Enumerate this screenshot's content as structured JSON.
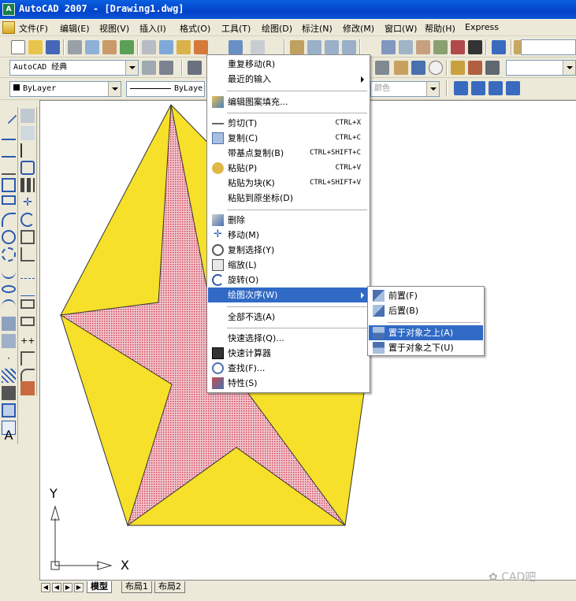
{
  "window": {
    "title": "AutoCAD 2007 - [Drawing1.dwg]",
    "app_icon": "autocad-icon"
  },
  "menubar": {
    "items": [
      "文件(F)",
      "编辑(E)",
      "视图(V)",
      "插入(I)",
      "格式(O)",
      "工具(T)",
      "绘图(D)",
      "标注(N)",
      "修改(M)",
      "窗口(W)",
      "帮助(H)",
      "Express"
    ]
  },
  "toolbar2": {
    "workspace": "AutoCAD 经典"
  },
  "toolbar3": {
    "layer_color": "ByLayer",
    "linetype": "ByLayer",
    "color_label": "颜色"
  },
  "context_menu": {
    "items": [
      {
        "label": "重复移动(R)",
        "shortcut": ""
      },
      {
        "label": "最近的输入",
        "shortcut": ""
      },
      {
        "label": "编辑图案填充...",
        "shortcut": ""
      },
      {
        "label": "剪切(T)",
        "shortcut": "CTRL+X"
      },
      {
        "label": "复制(C)",
        "shortcut": "CTRL+C"
      },
      {
        "label": "带基点复制(B)",
        "shortcut": "CTRL+SHIFT+C"
      },
      {
        "label": "粘贴(P)",
        "shortcut": "CTRL+V"
      },
      {
        "label": "粘贴为块(K)",
        "shortcut": "CTRL+SHIFT+V"
      },
      {
        "label": "粘贴到原坐标(D)",
        "shortcut": ""
      },
      {
        "label": "删除",
        "shortcut": ""
      },
      {
        "label": "移动(M)",
        "shortcut": ""
      },
      {
        "label": "复制选择(Y)",
        "shortcut": ""
      },
      {
        "label": "缩放(L)",
        "shortcut": ""
      },
      {
        "label": "旋转(O)",
        "shortcut": ""
      },
      {
        "label": "绘图次序(W)",
        "shortcut": ""
      },
      {
        "label": "全部不选(A)",
        "shortcut": ""
      },
      {
        "label": "快速选择(Q)...",
        "shortcut": ""
      },
      {
        "label": "快速计算器",
        "shortcut": ""
      },
      {
        "label": "查找(F)...",
        "shortcut": ""
      },
      {
        "label": "特性(S)",
        "shortcut": ""
      }
    ]
  },
  "submenu": {
    "items": [
      {
        "label": "前置(F)"
      },
      {
        "label": "后置(B)"
      },
      {
        "label": "置于对象之上(A)"
      },
      {
        "label": "置于对象之下(U)"
      }
    ]
  },
  "canvas": {
    "y_label": "Y",
    "x_label": "X"
  },
  "tabs": {
    "model": "模型",
    "layout1": "布局1",
    "layout2": "布局2"
  },
  "watermark": "CAD吧",
  "colors": {
    "pentagon": "#F6E02A",
    "star": "#E79AA0",
    "selection": "#316AC5"
  }
}
